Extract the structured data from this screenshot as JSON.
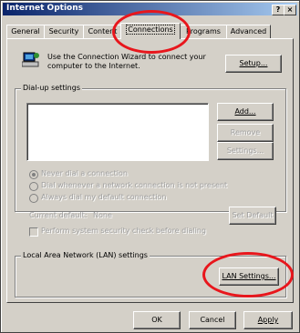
{
  "window": {
    "title": "Internet Options",
    "help_btn": "?",
    "close_btn": "×"
  },
  "tabs": [
    {
      "label": "General"
    },
    {
      "label": "Security"
    },
    {
      "label": "Content"
    },
    {
      "label": "Connections"
    },
    {
      "label": "Programs"
    },
    {
      "label": "Advanced"
    }
  ],
  "wizard": {
    "text_line1": "Use the Connection Wizard to connect your",
    "text_line2": "computer to the Internet.",
    "setup_label": "Setup..."
  },
  "dialup": {
    "legend": "Dial-up settings",
    "add_label": "Add...",
    "remove_label": "Remove",
    "settings_label": "Settings...",
    "options": [
      "Never dial a connection",
      "Dial whenever a network connection is not present",
      "Always dial my default connection"
    ],
    "current_default_label": "Current default:",
    "current_default_value": "None",
    "set_default_label": "Set Default",
    "perform_check_label": "Perform system security check before dialing"
  },
  "lan": {
    "legend": "Local Area Network (LAN) settings",
    "button_label": "LAN Settings..."
  },
  "footer": {
    "ok_label": "OK",
    "cancel_label": "Cancel",
    "apply_label": "Apply"
  },
  "highlight_color": "#e8161c"
}
